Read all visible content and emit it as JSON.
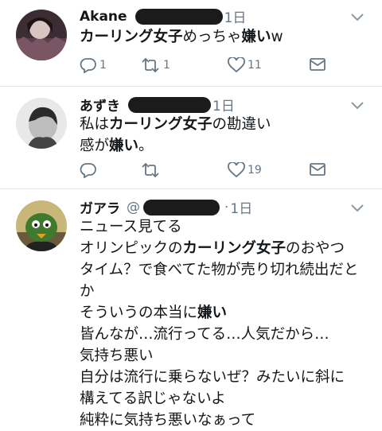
{
  "tweets": [
    {
      "author": "Akane",
      "time": "1日",
      "lines": [
        [
          {
            "t": "カーリング女子",
            "b": true
          },
          {
            "t": "めっちゃ",
            "b": false
          },
          {
            "t": "嫌い",
            "b": true
          },
          {
            "t": "w",
            "b": false
          }
        ]
      ],
      "counts": {
        "reply": "1",
        "retweet": "1",
        "like": "11",
        "dm": ""
      }
    },
    {
      "author": "あずき",
      "time": "1日",
      "lines": [
        [
          {
            "t": "私は",
            "b": false
          },
          {
            "t": "カーリング女子",
            "b": true
          },
          {
            "t": "の勘違い",
            "b": false
          }
        ],
        [
          {
            "t": "感が",
            "b": false
          },
          {
            "t": "嫌い",
            "b": true
          },
          {
            "t": "。",
            "b": false
          }
        ]
      ],
      "counts": {
        "reply": "",
        "retweet": "",
        "like": "19",
        "dm": ""
      }
    },
    {
      "author": "ガアラ",
      "handle_prefix": "@",
      "time": "1日",
      "lines": [
        [
          {
            "t": "ニュース見てる",
            "b": false
          }
        ],
        [
          {
            "t": "オリンピックの",
            "b": false
          },
          {
            "t": "カーリング女子",
            "b": true
          },
          {
            "t": "のおやつ",
            "b": false
          }
        ],
        [
          {
            "t": "タイム？で食べてた物が売り切れ続出だと",
            "b": false
          }
        ],
        [
          {
            "t": "か",
            "b": false
          }
        ],
        [
          {
            "t": "そういうの本当に",
            "b": false
          },
          {
            "t": "嫌い",
            "b": true
          }
        ],
        [
          {
            "t": "皆んなが…流行ってる…人気だから…",
            "b": false
          }
        ],
        [
          {
            "t": "気持ち悪い",
            "b": false
          }
        ],
        [
          {
            "t": "自分は流行に乗らないぜ？みたいに斜に",
            "b": false
          }
        ],
        [
          {
            "t": "構えてる訳じゃないよ",
            "b": false
          }
        ],
        [
          {
            "t": "純粋に気持ち悪いなぁって",
            "b": false
          }
        ]
      ]
    }
  ],
  "colors": {
    "muted": "#657786",
    "divider": "#e1e8ed",
    "redaction": "#1b1b1b",
    "text": "#14171a"
  },
  "icons": [
    "reply-icon",
    "retweet-icon",
    "like-icon",
    "dm-icon",
    "chevron-down-icon"
  ]
}
